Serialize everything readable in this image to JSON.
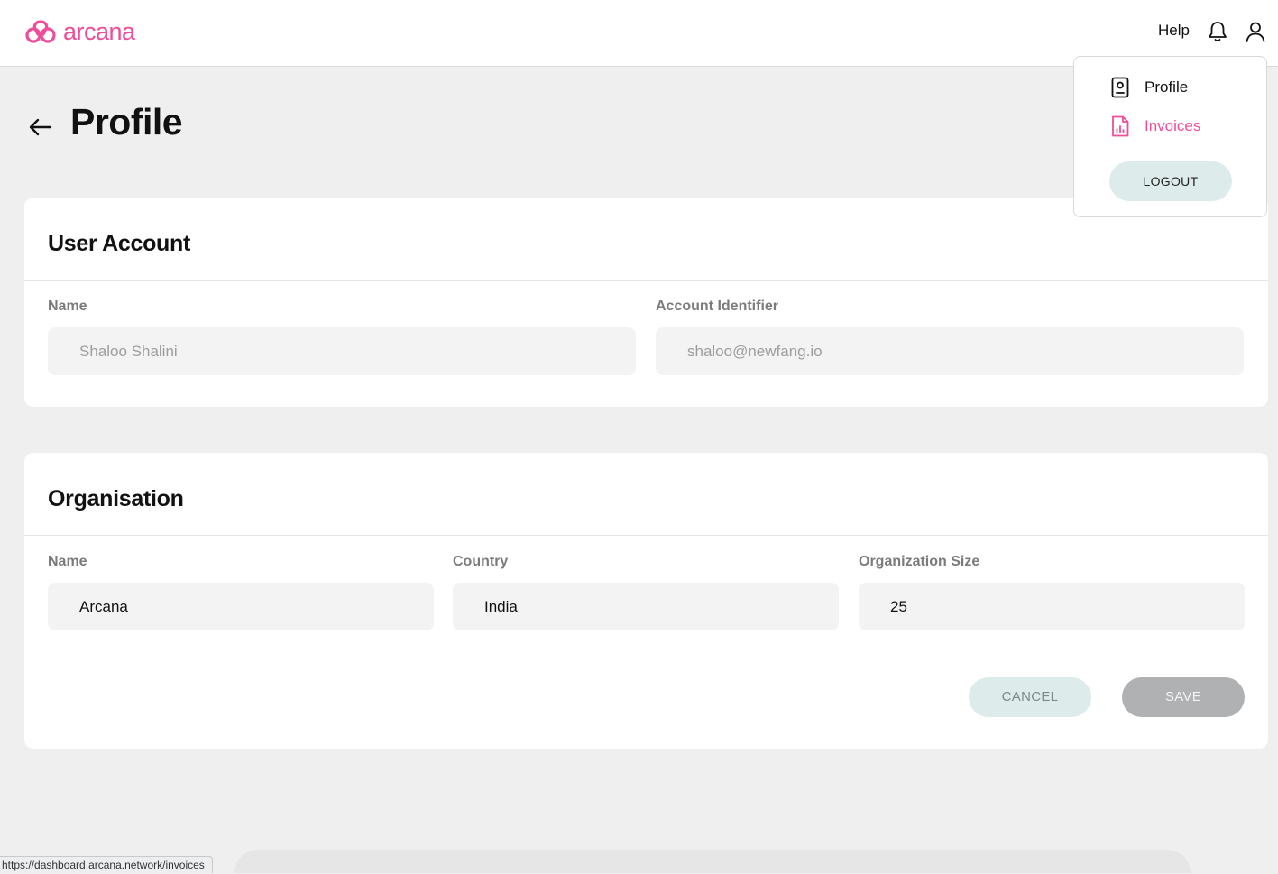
{
  "header": {
    "logo_text": "arcana",
    "help_label": "Help",
    "brand_color": "#ee4d9b",
    "icons": [
      "arcana-logo-icon",
      "bell-icon",
      "user-icon"
    ]
  },
  "page": {
    "title": "Profile",
    "back_icon": "arrow-left-icon"
  },
  "user_account": {
    "title": "User Account",
    "name_label": "Name",
    "name_value": "Shaloo Shalini",
    "identifier_label": "Account Identifier",
    "identifier_value": "shaloo@newfang.io"
  },
  "organisation": {
    "title": "Organisation",
    "name_label": "Name",
    "name_value": "Arcana",
    "country_label": "Country",
    "country_value": "India",
    "size_label": "Organization Size",
    "size_value": "25",
    "cancel_label": "CANCEL",
    "save_label": "SAVE"
  },
  "user_menu": {
    "items": [
      {
        "label": "Profile",
        "icon": "profile-badge-icon"
      },
      {
        "label": "Invoices",
        "icon": "invoice-icon"
      }
    ],
    "logout_label": "LOGOUT"
  },
  "status_bar": {
    "url": "https://dashboard.arcana.network/invoices"
  }
}
